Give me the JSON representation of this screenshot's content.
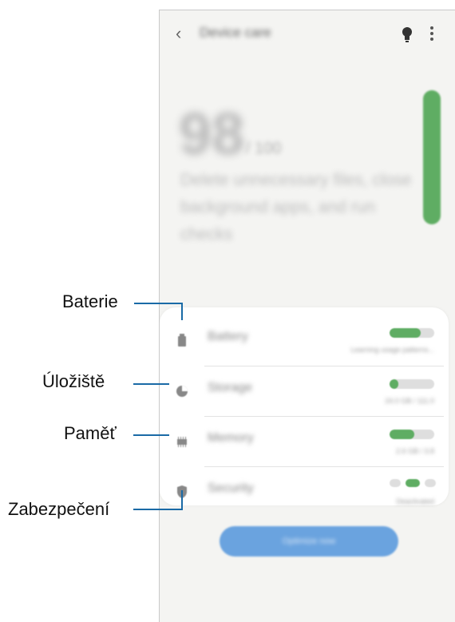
{
  "header": {
    "title": "Device care"
  },
  "summary": {
    "score": "98",
    "score_unit": "/ 100",
    "description": "Delete unnecessary files, close background apps, and run checks"
  },
  "items": [
    {
      "label": "Battery",
      "detail": "Learning usage patterns...",
      "progress": 0.7
    },
    {
      "label": "Storage",
      "detail": "24.0 GB / 111.0",
      "progress": 0.2
    },
    {
      "label": "Memory",
      "detail": "2.6 GB / 3.8",
      "progress": 0.55
    },
    {
      "label": "Security",
      "detail": "Deactivated"
    }
  ],
  "optimize_label": "Optimize now",
  "callouts": {
    "battery": "Baterie",
    "storage": "Úložiště",
    "memory": "Paměť",
    "security": "Zabezpečení"
  },
  "colors": {
    "accent_green": "#5fad63",
    "button_blue": "#6aa3df",
    "callout_line": "#1a6aa6"
  }
}
